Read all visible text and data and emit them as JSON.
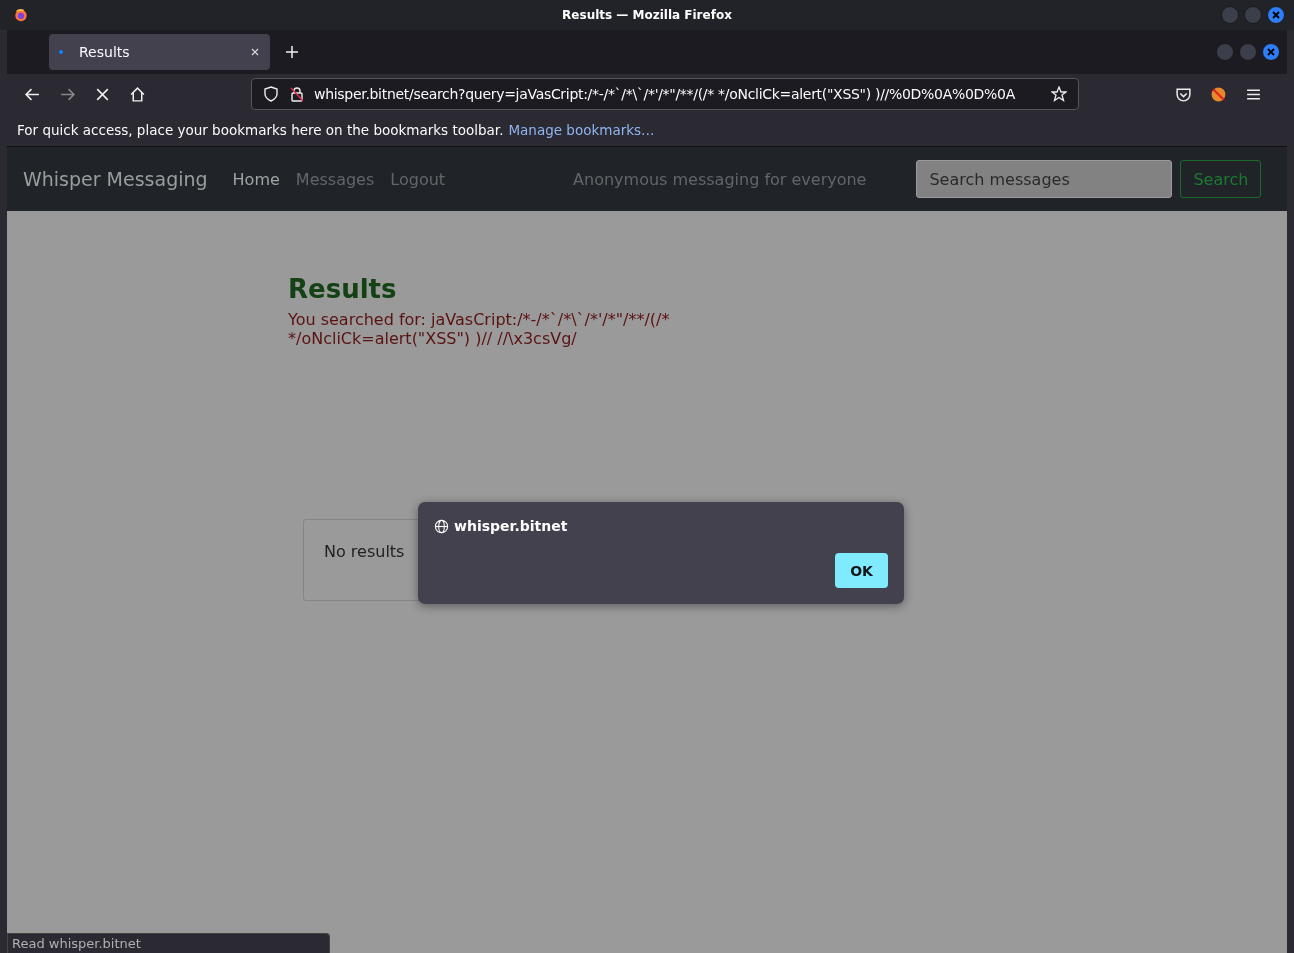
{
  "window": {
    "title": "Results — Mozilla Firefox"
  },
  "tabs": [
    {
      "label": "Results",
      "selected": true,
      "loading": true
    }
  ],
  "address_bar": {
    "url": "whisper.bitnet/search?query=jaVasCript:/*-/*`/*\\`/*'/*\"/**/(/* */oNcliCk=alert(\"XSS\") )//%0D%0A%0D%0A"
  },
  "bookmarks_bar": {
    "message": "For quick access, place your bookmarks here on the bookmarks toolbar.",
    "link": "Manage bookmarks…"
  },
  "site": {
    "brand": "Whisper Messaging",
    "nav": [
      {
        "label": "Home",
        "selected": true
      },
      {
        "label": "Messages",
        "selected": false
      },
      {
        "label": "Logout",
        "selected": false
      }
    ],
    "tagline": "Anonymous messaging for everyone",
    "search": {
      "placeholder": "Search messages",
      "button": "Search"
    },
    "heading": "Results",
    "searched_for": "You searched for: jaVasCript:/*-/*`/*\\`/*'/*\"/**/(/* */oNcliCk=alert(\"XSS\") )// //\\x3csVg/",
    "result_card": "No results"
  },
  "dialog": {
    "origin": "whisper.bitnet",
    "button": "OK"
  },
  "status_bar": "Read whisper.bitnet"
}
